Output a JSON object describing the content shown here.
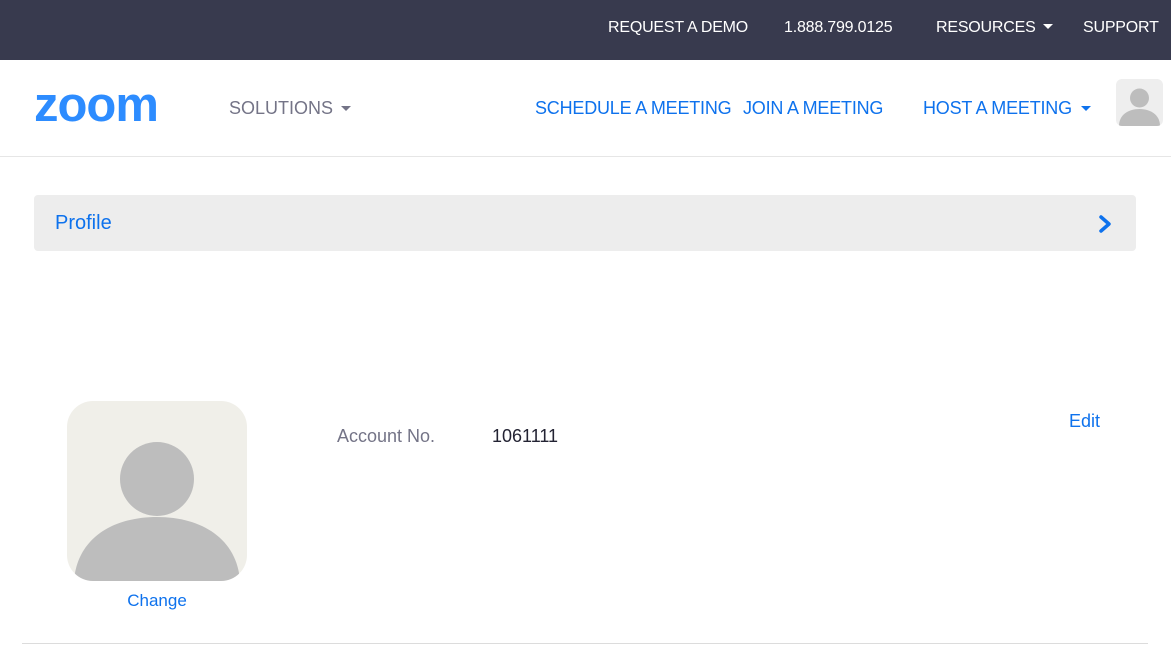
{
  "topbar": {
    "request_demo": "REQUEST A DEMO",
    "phone": "1.888.799.0125",
    "resources": "RESOURCES",
    "support": "SUPPORT"
  },
  "nav": {
    "logo_text": "zoom",
    "solutions": "SOLUTIONS",
    "schedule": "SCHEDULE A MEETING",
    "join": "JOIN A MEETING",
    "host": "HOST A MEETING",
    "avatar_icon": "user-avatar-icon"
  },
  "profile_bar": {
    "label": "Profile",
    "icon": "chevron-right-icon"
  },
  "profile": {
    "avatar_icon": "user-avatar-icon",
    "change": "Change",
    "account_label": "Account No.",
    "account_value": "1061111",
    "edit": "Edit"
  },
  "colors": {
    "topbar_bg": "#383a4e",
    "accent": "#0e72ed",
    "muted_text": "#747487",
    "panel_bg": "#ededed"
  }
}
